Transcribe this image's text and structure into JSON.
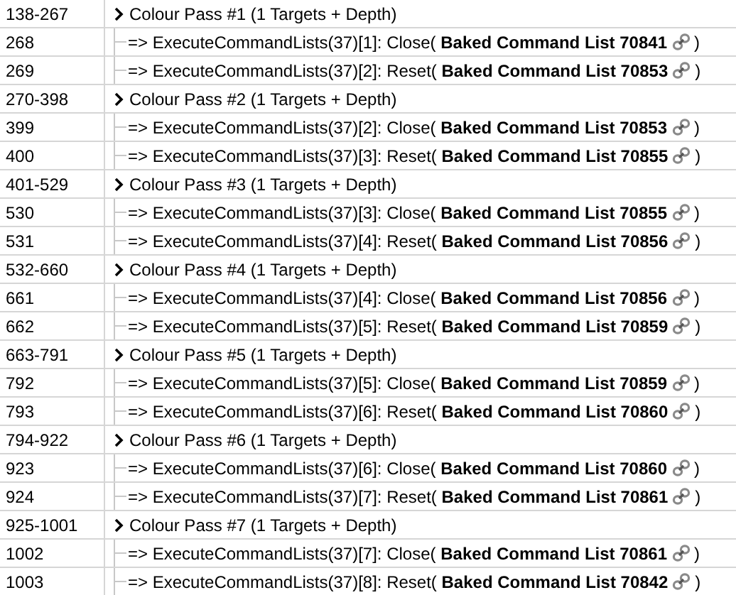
{
  "groups": [
    {
      "eid": "138-267",
      "label": "Colour Pass #1 (1 Targets + Depth)",
      "children": [
        {
          "eid": "268",
          "call": "=> ExecuteCommandLists(37)[1]: Close( **Baked Command List 70841**",
          "close": ")"
        },
        {
          "eid": "269",
          "call": "=> ExecuteCommandLists(37)[2]: Reset( **Baked Command List 70853**",
          "close": ")"
        }
      ]
    },
    {
      "eid": "270-398",
      "label": "Colour Pass #2 (1 Targets + Depth)",
      "children": [
        {
          "eid": "399",
          "call": "=> ExecuteCommandLists(37)[2]: Close( **Baked Command List 70853**",
          "close": ")"
        },
        {
          "eid": "400",
          "call": "=> ExecuteCommandLists(37)[3]: Reset( **Baked Command List 70855**",
          "close": ")"
        }
      ]
    },
    {
      "eid": "401-529",
      "label": "Colour Pass #3 (1 Targets + Depth)",
      "children": [
        {
          "eid": "530",
          "call": "=> ExecuteCommandLists(37)[3]: Close( **Baked Command List 70855**",
          "close": ")"
        },
        {
          "eid": "531",
          "call": "=> ExecuteCommandLists(37)[4]: Reset( **Baked Command List 70856**",
          "close": ")"
        }
      ]
    },
    {
      "eid": "532-660",
      "label": "Colour Pass #4 (1 Targets + Depth)",
      "children": [
        {
          "eid": "661",
          "call": "=> ExecuteCommandLists(37)[4]: Close( **Baked Command List 70856**",
          "close": ")"
        },
        {
          "eid": "662",
          "call": "=> ExecuteCommandLists(37)[5]: Reset( **Baked Command List 70859**",
          "close": ")"
        }
      ]
    },
    {
      "eid": "663-791",
      "label": "Colour Pass #5 (1 Targets + Depth)",
      "children": [
        {
          "eid": "792",
          "call": "=> ExecuteCommandLists(37)[5]: Close( **Baked Command List 70859**",
          "close": ")"
        },
        {
          "eid": "793",
          "call": "=> ExecuteCommandLists(37)[6]: Reset( **Baked Command List 70860**",
          "close": ")"
        }
      ]
    },
    {
      "eid": "794-922",
      "label": "Colour Pass #6 (1 Targets + Depth)",
      "children": [
        {
          "eid": "923",
          "call": "=> ExecuteCommandLists(37)[6]: Close( **Baked Command List 70860**",
          "close": ")"
        },
        {
          "eid": "924",
          "call": "=> ExecuteCommandLists(37)[7]: Reset( **Baked Command List 70861**",
          "close": ")"
        }
      ]
    },
    {
      "eid": "925-1001",
      "label": "Colour Pass #7 (1 Targets + Depth)",
      "children": [
        {
          "eid": "1002",
          "call": "=> ExecuteCommandLists(37)[7]: Close( **Baked Command List 70861**",
          "close": ")"
        },
        {
          "eid": "1003",
          "call": "=> ExecuteCommandLists(37)[8]: Reset( **Baked Command List 70842**",
          "close": ")"
        }
      ]
    }
  ]
}
